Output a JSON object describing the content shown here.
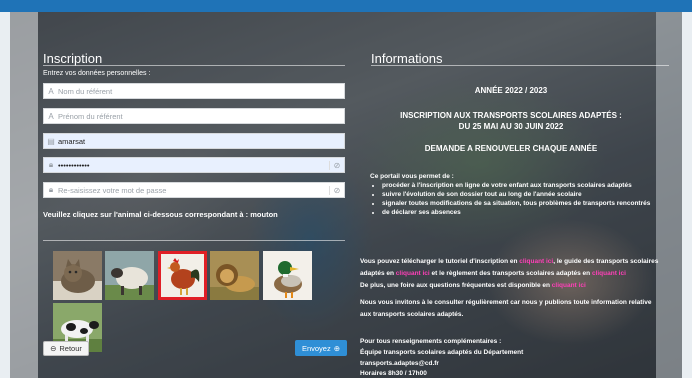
{
  "left": {
    "title": "Inscription",
    "subtitle": "Entrez vos données personnelles :",
    "fields": [
      {
        "placeholder": "Nom du référent",
        "value": ""
      },
      {
        "placeholder": "Prénom du référent",
        "value": ""
      },
      {
        "placeholder": "",
        "value": "amarsat"
      },
      {
        "placeholder": "",
        "value": "••••••••••••"
      },
      {
        "placeholder": "Re-saisissez votre mot de passe",
        "value": ""
      }
    ],
    "instruction": "Veuillez cliquez sur l'animal ci-dessous correspondant à : mouton",
    "animals": [
      "cat-image",
      "sheep-image",
      "rooster-image",
      "lion-image",
      "duck-image",
      "cow-image"
    ],
    "selected_animal_index": 2,
    "retour_label": "Retour",
    "envoyez_label": "Envoyez"
  },
  "right": {
    "title": "Informations",
    "annee": "ANNÉE 2022 / 2023",
    "inscription_line1": "INSCRIPTION AUX TRANSPORTS SCOLAIRES ADAPTÉS :",
    "inscription_line2": "DU 25 MAI AU 30 JUIN 2022",
    "demande": "DEMANDE A RENOUVELER CHAQUE ANNÉE",
    "portail_intro": "Ce portail vous permet de :",
    "bullets": [
      "procéder à l'inscription en ligne de votre enfant aux transports scolaires adaptés",
      "suivre l'évolution de son dossier tout au long de l'année scolaire",
      "signaler toutes modifications de sa situation, tous problèmes de transports rencontrés",
      "de déclarer ses absences"
    ],
    "p1_a": "Vous pouvez télécharger le tutoriel d'inscription en",
    "p1_link1": "cliquant ici",
    "p1_b": ", le guide des transports scolaires",
    "p2_a": "adaptés en",
    "p2_link2": "cliquant ici",
    "p2_b": "et le règlement des transports scolaires adaptés en",
    "p2_link3": "cliquant ici",
    "p3_a": "De plus, une foire aux questions fréquentes est disponible en",
    "p3_link4": "cliquant ici",
    "p4": "Nous vous invitons à le consulter régulièrement car nous y publions toute information relative",
    "p5": "aux transports scolaires adaptés.",
    "contact1": "Pour tous renseignements complémentaires :",
    "contact2": "Équipe transports scolaires adaptés du Département",
    "contact_email": "transports.adaptes@cd.fr",
    "horaires": "Horaires 8h30 / 17h00"
  },
  "colors": {
    "accent": "#2f8fd6",
    "topbar": "#1f73b7",
    "link": "#ff3fb8",
    "selected": "#e01f26"
  }
}
